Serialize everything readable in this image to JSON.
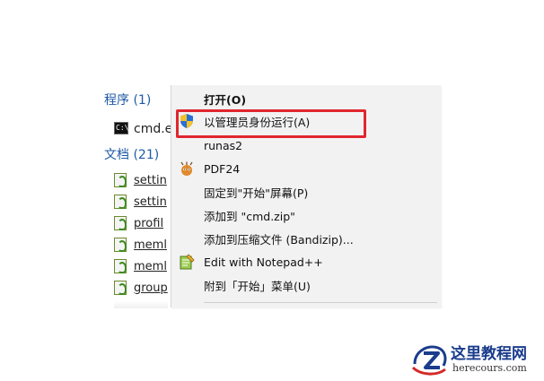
{
  "search_results": {
    "programs_header": "程序 (1)",
    "documents_header": "文档 (21)",
    "programs": [
      {
        "name": "cmd.e",
        "icon": "cmd-icon"
      }
    ],
    "documents": [
      {
        "name": "settin",
        "icon": "script-icon"
      },
      {
        "name": "settin",
        "icon": "script-icon"
      },
      {
        "name": "profil",
        "icon": "script-icon"
      },
      {
        "name": "meml",
        "icon": "script-icon"
      },
      {
        "name": "meml",
        "icon": "script-icon"
      },
      {
        "name": "group",
        "icon": "script-icon"
      }
    ]
  },
  "context_menu": {
    "items": [
      {
        "label": "打开(O)",
        "icon": "",
        "bold": true
      },
      {
        "label": "以管理员身份运行(A)",
        "icon": "uac-shield-icon",
        "highlighted": true
      },
      {
        "label": "runas2",
        "icon": ""
      },
      {
        "label": "PDF24",
        "icon": "pdf24-icon"
      },
      {
        "label": "固定到\"开始\"屏幕(P)",
        "icon": ""
      },
      {
        "label": "添加到 \"cmd.zip\"",
        "icon": ""
      },
      {
        "label": "添加到压缩文件 (Bandizip)...",
        "icon": ""
      },
      {
        "label": "Edit with Notepad++",
        "icon": "notepad-plus-plus-icon"
      },
      {
        "label": "附到「开始」菜单(U)",
        "icon": ""
      }
    ],
    "highlight_color": "#e0262e"
  },
  "watermark": {
    "title": "这里教程网",
    "url": "herecours.com",
    "color": "#1a3c8c"
  }
}
